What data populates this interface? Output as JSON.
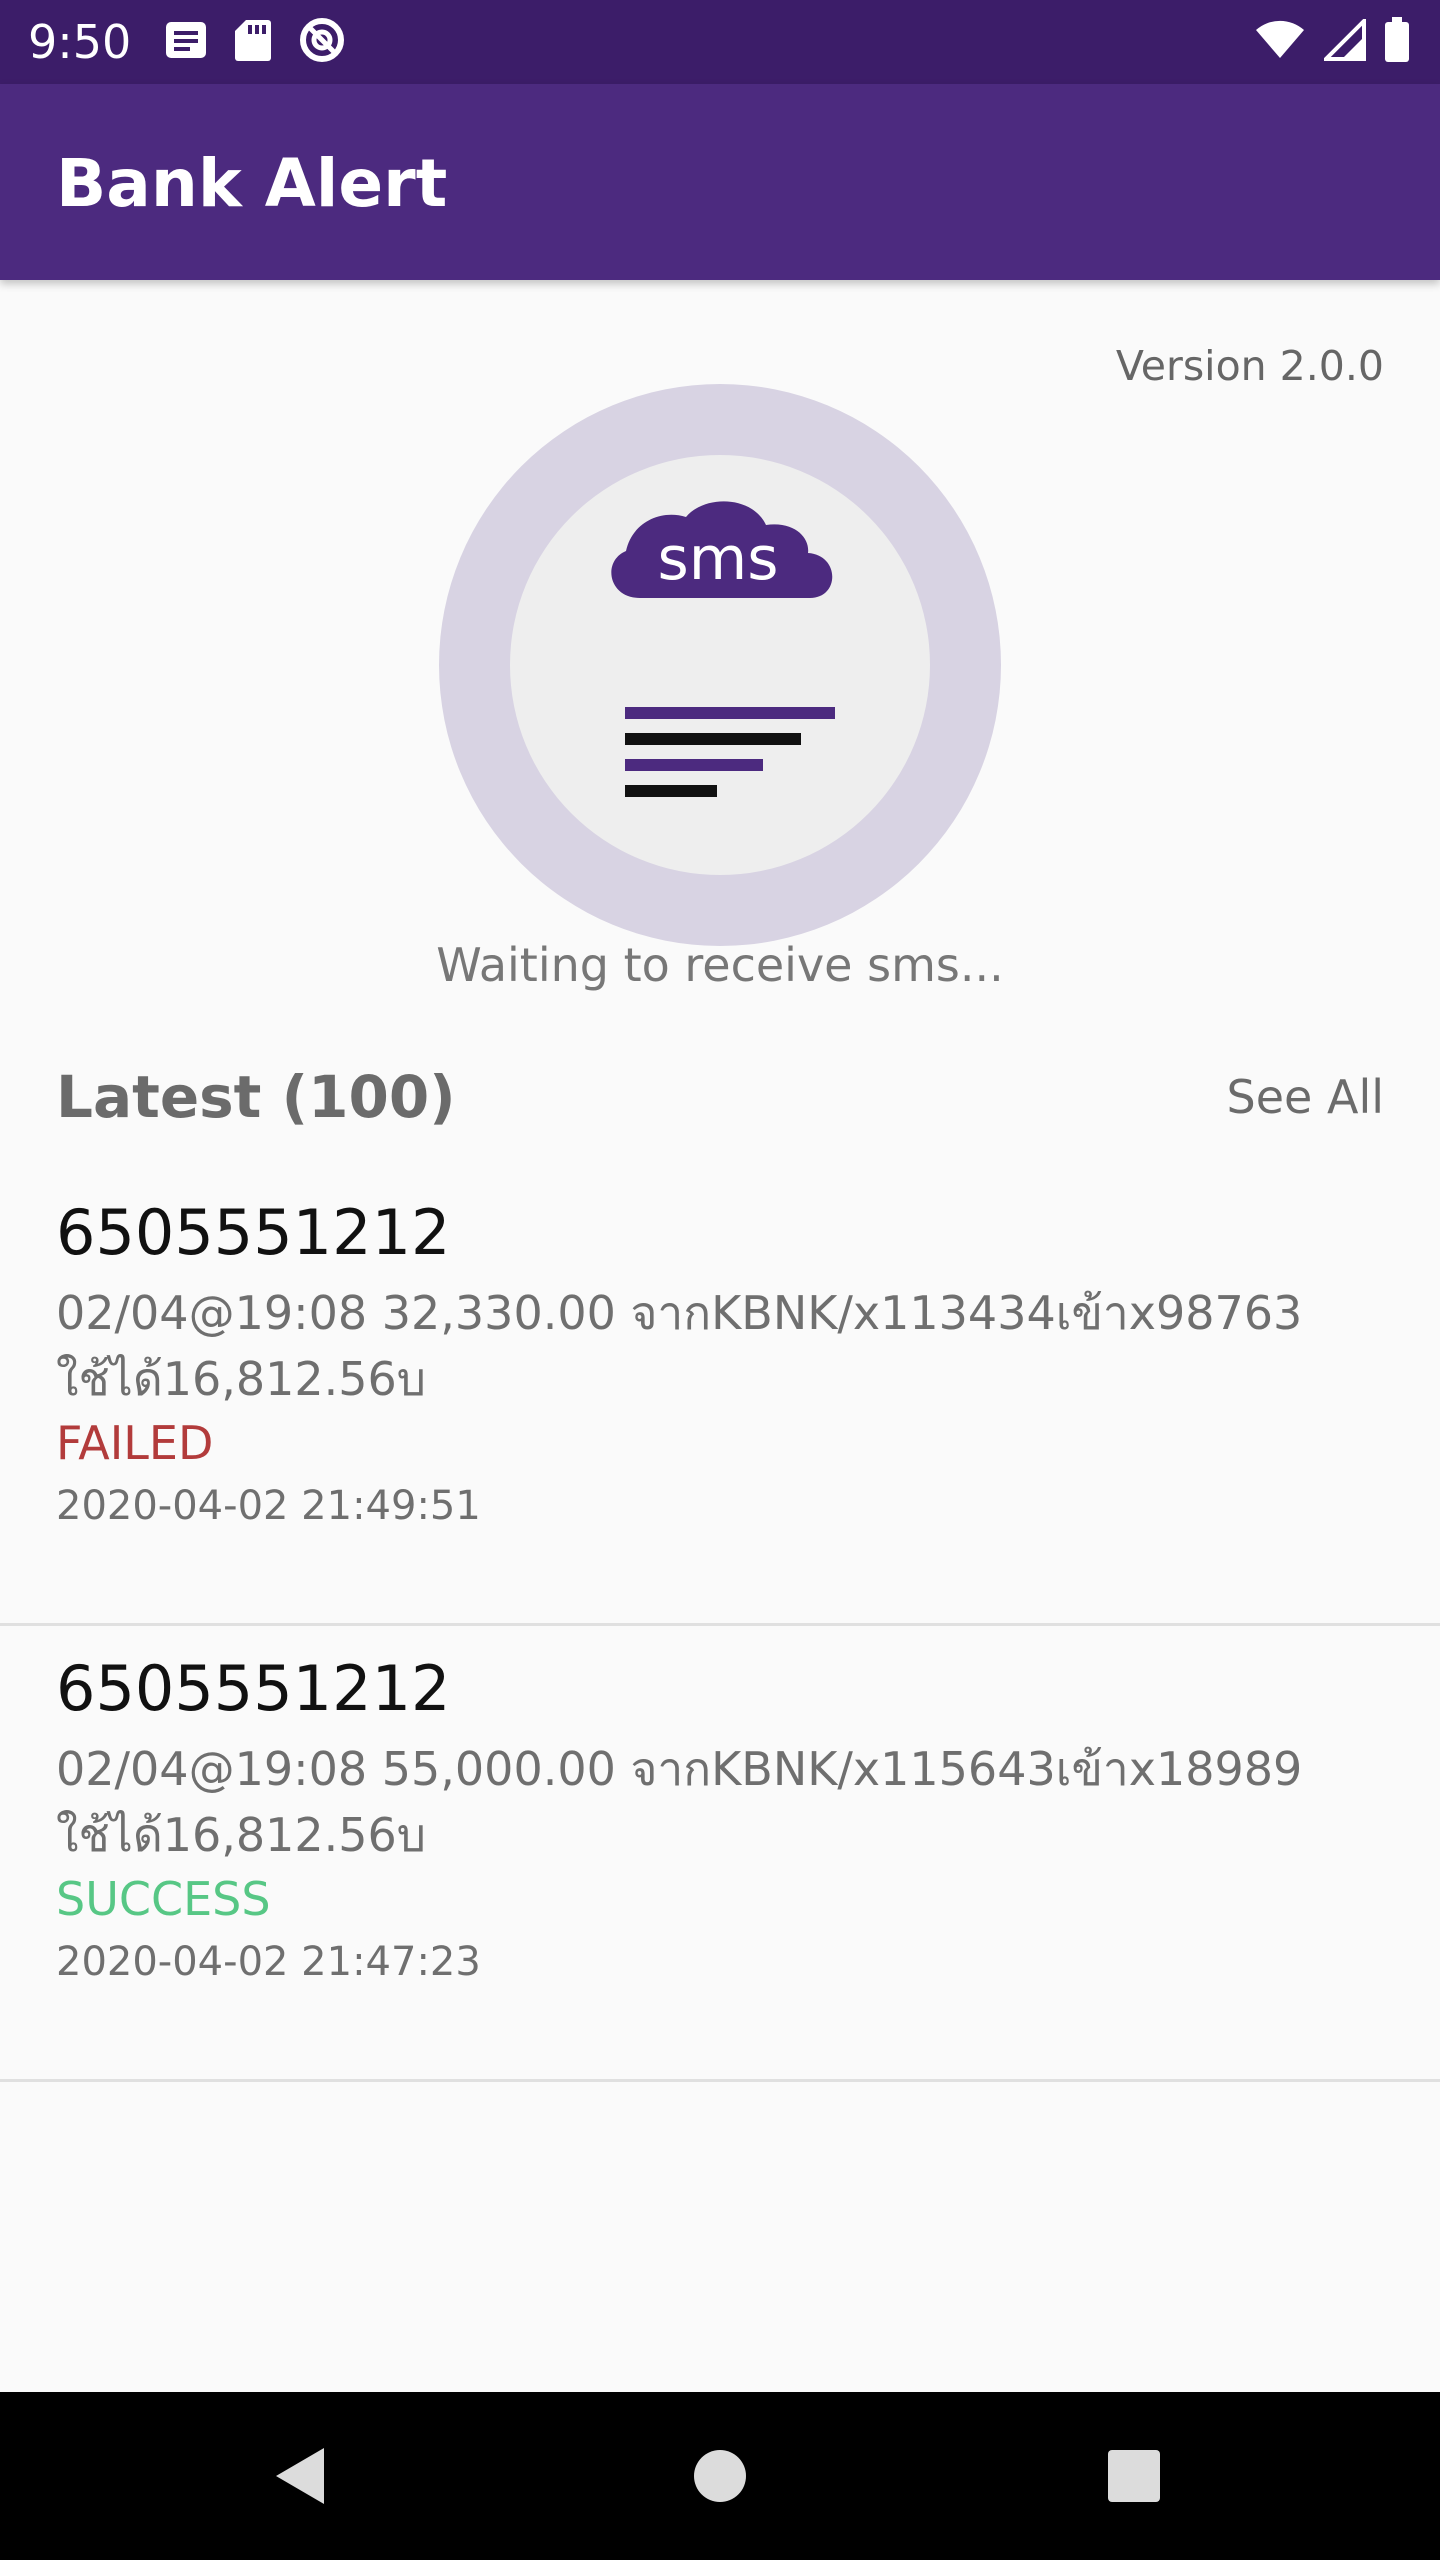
{
  "status_bar": {
    "time": "9:50",
    "left_icons": [
      "message-icon",
      "sd-card-icon",
      "at-sign-icon"
    ],
    "right_icons": [
      "wifi-icon",
      "signal-icon",
      "battery-icon"
    ]
  },
  "app_bar": {
    "title": "Bank Alert"
  },
  "version": "Version 2.0.0",
  "hero": {
    "icon": "sms-cloud-icon",
    "icon_text": "sms",
    "waiting_text": "Waiting to receive sms..."
  },
  "latest": {
    "title": "Latest (100)",
    "see_all": "See All"
  },
  "messages": [
    {
      "sender": "6505551212",
      "body": "02/04@19:08 32,330.00 จากKBNK/x113434เข้าx98763 ใช้ได้16,812.56บ",
      "status": "FAILED",
      "timestamp": "2020-04-02 21:49:51"
    },
    {
      "sender": "6505551212",
      "body": "02/04@19:08 55,000.00 จากKBNK/x115643เข้าx18989 ใช้ได้16,812.56บ",
      "status": "SUCCESS",
      "timestamp": "2020-04-02 21:47:23"
    }
  ],
  "nav_bar": {
    "buttons": [
      "back-icon",
      "home-icon",
      "recents-icon"
    ]
  },
  "colors": {
    "status_bar": "#3c1d69",
    "app_bar": "#4c2a7f",
    "failed": "#b23b3b",
    "success": "#57c785",
    "hero_ring": "#d8d3e3"
  }
}
